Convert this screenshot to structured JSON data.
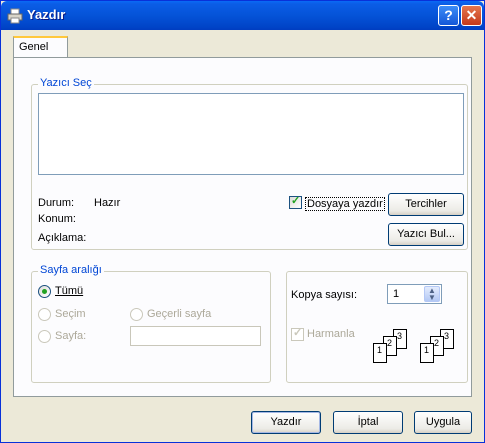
{
  "window": {
    "title": "Yazdır",
    "help_icon": "help-icon",
    "close_icon": "close-icon",
    "app_icon": "printer-icon"
  },
  "tabs": [
    {
      "label": "Genel"
    }
  ],
  "printer_group": {
    "legend": "Yazıcı Seç",
    "status_label": "Durum:",
    "status_value": "Hazır",
    "location_label": "Konum:",
    "comment_label": "Açıklama:",
    "print_to_file_label": "Dosyaya yazdır",
    "print_to_file_checked": true,
    "preferences_button": "Tercihler",
    "find_printer_button": "Yazıcı Bul..."
  },
  "page_range": {
    "legend": "Sayfa aralığı",
    "all_label": "Tümü",
    "all_selected": true,
    "selection_label": "Seçim",
    "current_page_label": "Geçerli sayfa",
    "pages_label": "Sayfa:",
    "pages_value": ""
  },
  "copies": {
    "label": "Kopya sayısı:",
    "value": "1",
    "collate_label": "Harmanla",
    "collate_checked": true,
    "collate_pages": [
      "1",
      "2",
      "3"
    ]
  },
  "footer": {
    "print_button": "Yazdır",
    "cancel_button": "İptal",
    "apply_button": "Uygula"
  }
}
